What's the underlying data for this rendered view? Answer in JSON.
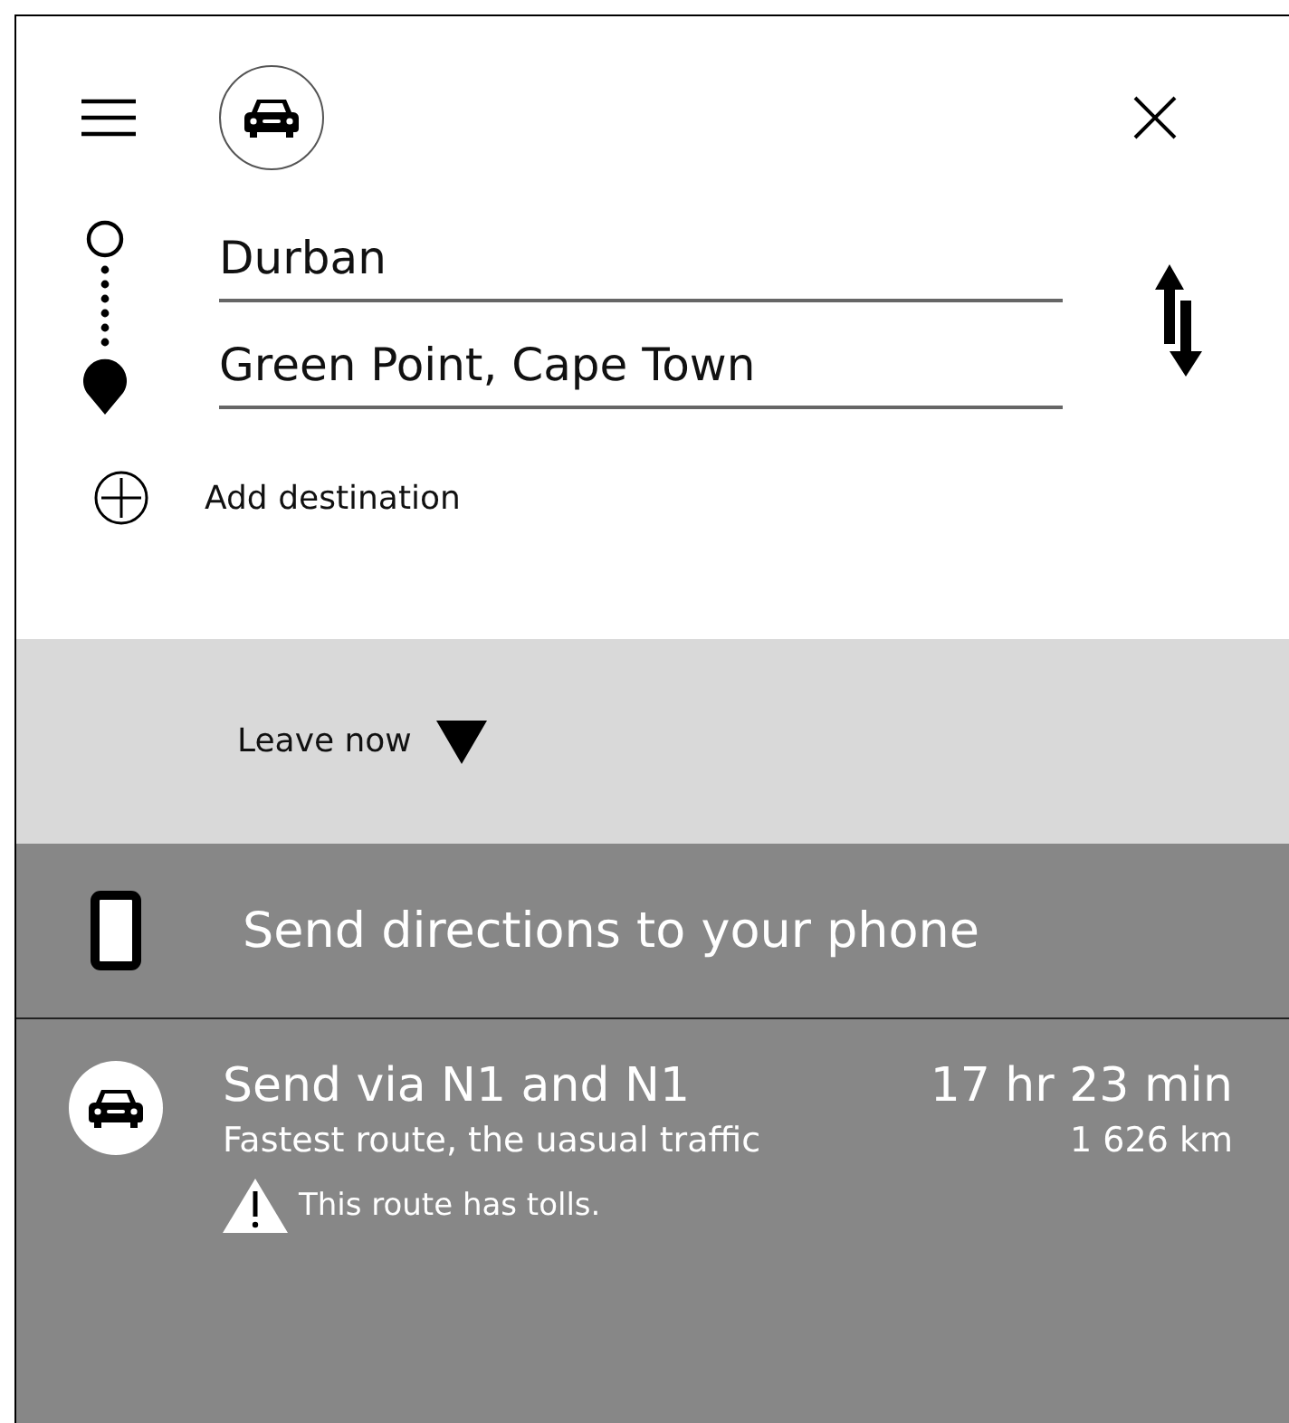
{
  "origin": {
    "value": "Durban"
  },
  "destination": {
    "value": "Green Point, Cape Town"
  },
  "add_destination": "Add destination",
  "departure": {
    "label": "Leave now"
  },
  "send_to_phone": "Send directions to your phone",
  "routes": [
    {
      "title": "Send via N1 and N1",
      "duration": "17 hr 23 min",
      "description": "Fastest route, the uasual traffic",
      "distance": "1 626 km",
      "warning": "This route has tolls."
    }
  ]
}
